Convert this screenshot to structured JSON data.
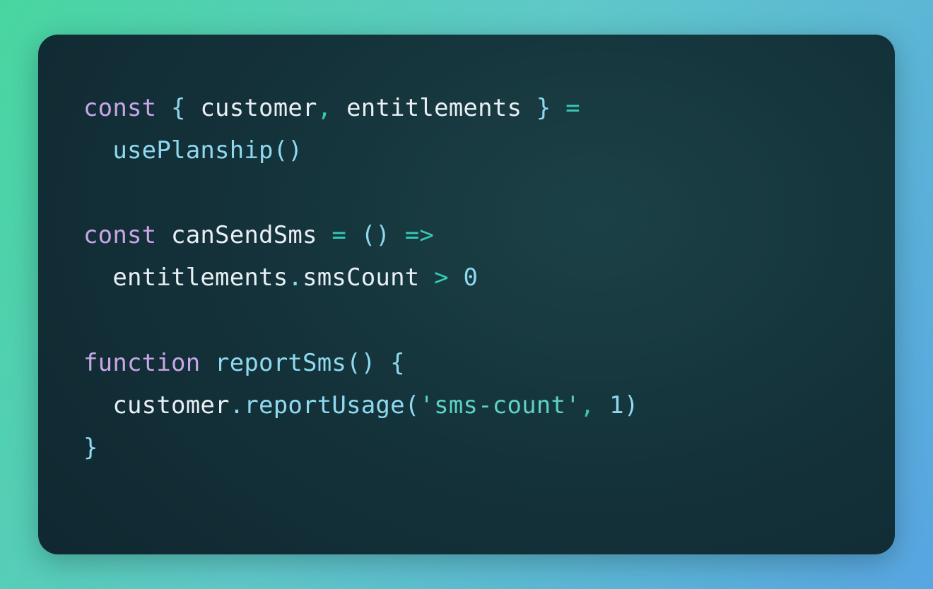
{
  "code": {
    "tokens": [
      {
        "cls": "kw",
        "t": "const"
      },
      {
        "cls": "id",
        "t": " "
      },
      {
        "cls": "pun",
        "t": "{"
      },
      {
        "cls": "id",
        "t": " customer"
      },
      {
        "cls": "op",
        "t": ","
      },
      {
        "cls": "id",
        "t": " entitlements "
      },
      {
        "cls": "pun",
        "t": "}"
      },
      {
        "cls": "id",
        "t": " "
      },
      {
        "cls": "op",
        "t": "="
      },
      {
        "cls": "nl",
        "t": "\n"
      },
      {
        "cls": "id",
        "t": "  "
      },
      {
        "cls": "fn",
        "t": "usePlanship"
      },
      {
        "cls": "pun",
        "t": "()"
      },
      {
        "cls": "nl",
        "t": "\n"
      },
      {
        "cls": "nl",
        "t": "\n"
      },
      {
        "cls": "kw",
        "t": "const"
      },
      {
        "cls": "id",
        "t": " canSendSms "
      },
      {
        "cls": "op",
        "t": "="
      },
      {
        "cls": "id",
        "t": " "
      },
      {
        "cls": "pun",
        "t": "()"
      },
      {
        "cls": "id",
        "t": " "
      },
      {
        "cls": "op",
        "t": "=>"
      },
      {
        "cls": "nl",
        "t": "\n"
      },
      {
        "cls": "id",
        "t": "  entitlements"
      },
      {
        "cls": "pun",
        "t": "."
      },
      {
        "cls": "id",
        "t": "smsCount "
      },
      {
        "cls": "op",
        "t": ">"
      },
      {
        "cls": "id",
        "t": " "
      },
      {
        "cls": "num",
        "t": "0"
      },
      {
        "cls": "nl",
        "t": "\n"
      },
      {
        "cls": "nl",
        "t": "\n"
      },
      {
        "cls": "kw",
        "t": "function"
      },
      {
        "cls": "id",
        "t": " "
      },
      {
        "cls": "fn",
        "t": "reportSms"
      },
      {
        "cls": "pun",
        "t": "()"
      },
      {
        "cls": "id",
        "t": " "
      },
      {
        "cls": "pun",
        "t": "{"
      },
      {
        "cls": "nl",
        "t": "\n"
      },
      {
        "cls": "id",
        "t": "  customer"
      },
      {
        "cls": "pun",
        "t": "."
      },
      {
        "cls": "fn",
        "t": "reportUsage"
      },
      {
        "cls": "pun",
        "t": "("
      },
      {
        "cls": "str",
        "t": "'sms-count'"
      },
      {
        "cls": "op",
        "t": ","
      },
      {
        "cls": "id",
        "t": " "
      },
      {
        "cls": "num",
        "t": "1"
      },
      {
        "cls": "pun",
        "t": ")"
      },
      {
        "cls": "nl",
        "t": "\n"
      },
      {
        "cls": "pun",
        "t": "}"
      }
    ],
    "language": "javascript"
  }
}
